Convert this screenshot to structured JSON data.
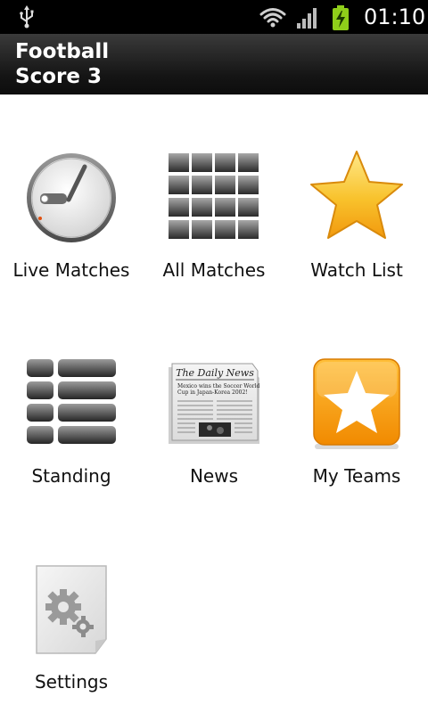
{
  "status_bar": {
    "time": "01:10",
    "icons": [
      "usb-icon",
      "wifi-icon",
      "signal-icon",
      "battery-charging-icon"
    ]
  },
  "app": {
    "title": "Football\nScore 3"
  },
  "menu": {
    "items": [
      {
        "label": "Live Matches",
        "icon": "stopwatch-icon"
      },
      {
        "label": "All Matches",
        "icon": "grid-icon"
      },
      {
        "label": "Watch List",
        "icon": "star-icon"
      },
      {
        "label": "Standing",
        "icon": "table-rows-icon"
      },
      {
        "label": "News",
        "icon": "newspaper-icon"
      },
      {
        "label": "My Teams",
        "icon": "star-badge-icon"
      },
      {
        "label": "Settings",
        "icon": "gears-icon"
      }
    ],
    "newspaper_masthead": "The Daily News",
    "newspaper_headline": "Mexico wins the Soccer World Cup in Japan-Korea 2002!"
  },
  "colors": {
    "title_bar": "#1a1a1a",
    "accent_orange": "#f6a21a",
    "star_yellow": "#f9c623"
  }
}
